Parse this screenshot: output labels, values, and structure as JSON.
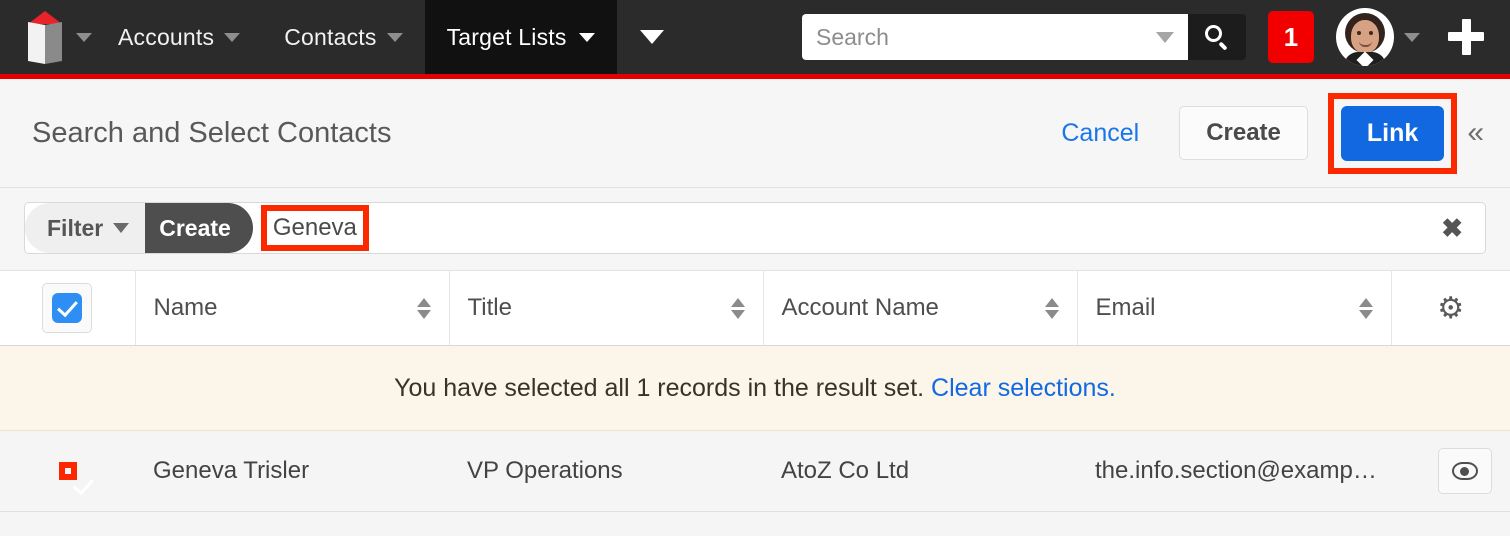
{
  "navbar": {
    "logo_name": "sugar-cube-logo",
    "tabs": [
      {
        "label": "Accounts",
        "active": false
      },
      {
        "label": "Contacts",
        "active": false
      },
      {
        "label": "Target Lists",
        "active": true
      }
    ],
    "more_tabs_icon": "chevron-down-icon",
    "search": {
      "placeholder": "Search",
      "value": "",
      "dropdown_icon": "caret-down-icon",
      "submit_icon": "magnifier-icon"
    },
    "notification_count": "1",
    "avatar_name": "user-avatar",
    "avatar_caret_icon": "caret-down-icon",
    "quick_create_icon": "plus-icon",
    "accent_color": "#e60000",
    "background_color": "#2b2b2b"
  },
  "header": {
    "title": "Search and Select Contacts",
    "cancel_label": "Cancel",
    "create_label": "Create",
    "link_label": "Link",
    "collapse_icon": "«",
    "link_accent_color": "#1168e0",
    "annotation_color": "#fc2800"
  },
  "filter_bar": {
    "filter_label": "Filter",
    "filter_caret_icon": "caret-down-icon",
    "create_label": "Create",
    "search_term": "Geneva",
    "clear_icon": "✖"
  },
  "table": {
    "select_all_checked": true,
    "columns": [
      {
        "label": "Name",
        "sortable": true
      },
      {
        "label": "Title",
        "sortable": true
      },
      {
        "label": "Account Name",
        "sortable": true
      },
      {
        "label": "Email",
        "sortable": true
      }
    ],
    "settings_icon": "gear-icon",
    "banner": {
      "text": "You have selected all 1 records in the result set.",
      "link_text": "Clear selections."
    },
    "rows": [
      {
        "checked": true,
        "name": "Geneva Trisler",
        "title": "VP Operations",
        "account_name": "AtoZ Co Ltd",
        "email": "the.info.section@examp…",
        "preview_icon": "eye-icon"
      }
    ]
  }
}
